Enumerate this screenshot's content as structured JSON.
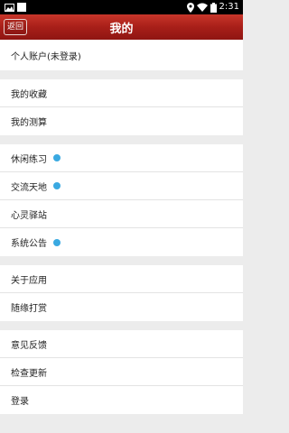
{
  "status_bar": {
    "time": "2:31",
    "icons": [
      "image-icon",
      "notification-square-icon",
      "location-icon",
      "wifi-icon",
      "battery-icon"
    ]
  },
  "header": {
    "back_label": "返回",
    "title": "我的"
  },
  "menu": {
    "account": "个人账户(未登录)",
    "favorites": "我的收藏",
    "calculations": "我的测算",
    "leisure_practice": "休闲练习",
    "exchange": "交流天地",
    "heart_station": "心灵驿站",
    "announcements": "系统公告",
    "about": "关于应用",
    "donate": "随缘打赏",
    "feedback": "意见反馈",
    "check_update": "检查更新",
    "login": "登录"
  },
  "colors": {
    "header_red": "#a81f19",
    "badge_blue": "#3aa9e1",
    "background": "#ececec"
  }
}
